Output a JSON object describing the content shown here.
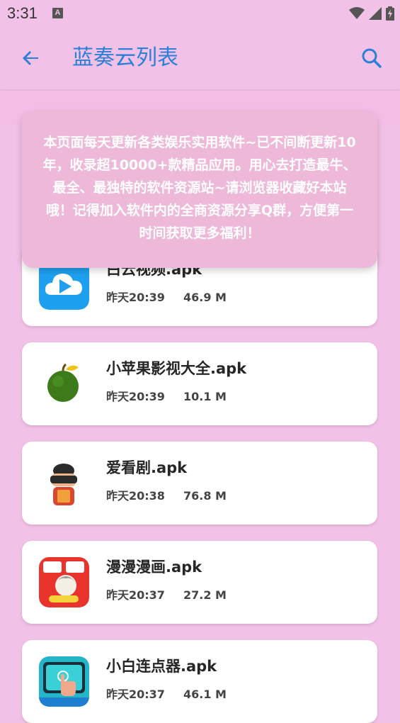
{
  "status_bar": {
    "time": "3:31",
    "notification_icon": "a-icon",
    "wifi_icon": "wifi-icon",
    "signal_icon": "signal-icon",
    "battery_icon": "battery-charging-icon"
  },
  "app_bar": {
    "title": "蓝奏云列表",
    "back_icon": "arrow-back-icon",
    "search_icon": "search-icon",
    "accent_color": "#2a7fd6"
  },
  "notice": {
    "text": "本页面每天更新各类娱乐实用软件~已不间断更新10年，收录超10000+款精品应用。用心去打造最牛、最全、最独特的软件资源站~请浏览器收藏好本站哦！记得加入软件内的全商资源分享Q群，方便第一时间获取更多福利！"
  },
  "files": [
    {
      "name": "白云视频.apk",
      "time": "昨天20:39",
      "size": "46.9 M",
      "icon": "cloud-play-icon"
    },
    {
      "name": "小苹果影视大全.apk",
      "time": "昨天20:39",
      "size": "10.1 M",
      "icon": "green-apple-icon"
    },
    {
      "name": "爱看剧.apk",
      "time": "昨天20:38",
      "size": "76.8 M",
      "icon": "vr-character-icon"
    },
    {
      "name": "漫漫漫画.apk",
      "time": "昨天20:37",
      "size": "27.2 M",
      "icon": "manga-icon"
    },
    {
      "name": "小白连点器.apk",
      "time": "昨天20:37",
      "size": "46.1 M",
      "icon": "tap-hand-icon"
    }
  ],
  "colors": {
    "background": "#f2c1e7",
    "notice_background": "#eeb9d9",
    "card_background": "#ffffff"
  }
}
